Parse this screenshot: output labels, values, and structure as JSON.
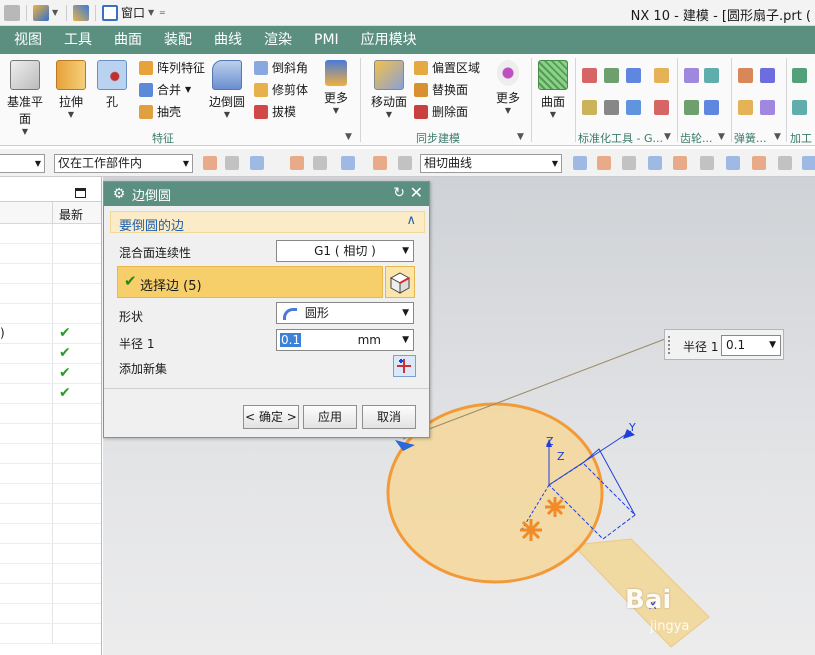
{
  "window": {
    "title": "NX 10 - 建模 - [圆形扇子.prt  ("
  },
  "quick_access": {
    "window_menu_label": "窗口"
  },
  "menu_tabs": [
    "视图",
    "工具",
    "曲面",
    "装配",
    "曲线",
    "渲染",
    "PMI",
    "应用模块"
  ],
  "ribbon": {
    "feature_group": {
      "label": "特征",
      "datum_plane": "基准平面",
      "extrude": "拉伸",
      "hole": "孔",
      "pattern_feature": "阵列特征",
      "unite": "合并",
      "subtract": "抽壳",
      "edge_blend": "边倒圆",
      "chamfer": "倒斜角",
      "trim_body": "修剪体",
      "draft": "拔模",
      "more": "更多"
    },
    "sync_group": {
      "label": "同步建模",
      "move_face": "移动面",
      "offset_region": "偏置区域",
      "replace_face": "替换面",
      "delete_face": "删除面",
      "more": "更多"
    },
    "surface_label": "曲面",
    "std_tools_label": "标准化工具 - G...",
    "gear_label": "齿轮...",
    "spring_label": "弹簧...",
    "machining_label": "加工"
  },
  "selection_bar": {
    "type_filter": "",
    "scope_filter": "仅在工作部件内",
    "curve_rule": "相切曲线"
  },
  "navigator": {
    "column_latest": "最新",
    "partial_text": ")"
  },
  "dialog": {
    "title": "边倒圆",
    "section_title": "要倒圆的边",
    "blend_continuity_label": "混合面连续性",
    "blend_continuity_value": "G1 ( 相切 )",
    "select_edge_label": "选择边 (5)",
    "shape_label": "形状",
    "shape_value": "圆形",
    "radius_label": "半径 1",
    "radius_value": "0.1",
    "radius_unit": "mm",
    "add_set_label": "添加新集",
    "ok_label": "< 确定 >",
    "apply_label": "应用",
    "cancel_label": "取消"
  },
  "floating_input": {
    "label": "半径 1",
    "value": "0.1"
  },
  "viewport": {
    "axis_x": "X",
    "axis_y": "Y",
    "axis_z": "Z",
    "axis_z2": "Z"
  },
  "watermark": {
    "main": "Bai",
    "sub": "jingya"
  },
  "colors": {
    "accent": "#5b8f7f",
    "selection": "#f7cf6a",
    "part_fill": "#f5d79a",
    "part_edge": "#f29a38"
  }
}
